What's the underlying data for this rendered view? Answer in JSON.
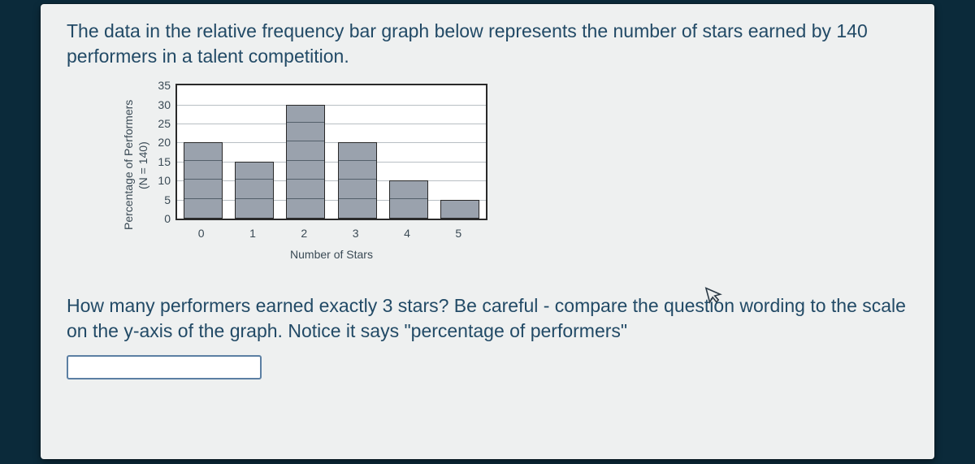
{
  "intro": "The data in the relative frequency bar graph below represents the number of stars earned by 140 performers in a talent competition.",
  "question": "How many performers earned exactly 3 stars? Be careful - compare the question wording to the scale on the y-axis of the graph. Notice it says \"percentage of performers\"",
  "answer_value": "",
  "cursor_glyph": "↖",
  "chart_data": {
    "type": "bar",
    "categories": [
      "0",
      "1",
      "2",
      "3",
      "4",
      "5"
    ],
    "values": [
      20,
      15,
      30,
      20,
      10,
      5
    ],
    "xlabel": "Number of Stars",
    "ylabel_line1": "Percentage of Performers",
    "ylabel_line2": "(N = 140)",
    "ylim": [
      0,
      35
    ],
    "yticks": [
      0,
      5,
      10,
      15,
      20,
      25,
      30,
      35
    ]
  }
}
